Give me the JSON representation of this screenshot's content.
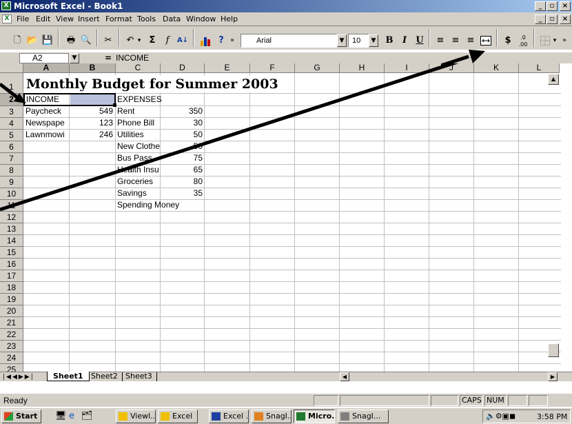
{
  "window": {
    "title": "Microsoft Excel - Book1"
  },
  "menu": [
    "File",
    "Edit",
    "View",
    "Insert",
    "Format",
    "Tools",
    "Data",
    "Window",
    "Help"
  ],
  "toolbar": {
    "font_name": "Arial",
    "font_size": "10",
    "bold": "B",
    "italic": "I",
    "underline": "U",
    "currency": "$"
  },
  "formula_bar": {
    "name_box": "A2",
    "equals": "=",
    "content": "INCOME"
  },
  "columns": [
    "A",
    "B",
    "C",
    "D",
    "E",
    "F",
    "G",
    "H",
    "I",
    "J",
    "K",
    "L"
  ],
  "rows": [
    "1",
    "2",
    "3",
    "4",
    "5",
    "6",
    "7",
    "8",
    "9",
    "10",
    "11",
    "12",
    "13",
    "14",
    "15",
    "16",
    "17",
    "18",
    "19",
    "20",
    "21",
    "22",
    "23",
    "24",
    "25"
  ],
  "sheet": {
    "title": "Monthly Budget for Summer 2003",
    "a2": "INCOME",
    "c2": "EXPENSES",
    "income": [
      {
        "label": "Paycheck",
        "value": "549"
      },
      {
        "label": "Newspape",
        "value": "123"
      },
      {
        "label": "Lawnmowi",
        "value": "246"
      }
    ],
    "expenses": [
      {
        "label": "Rent",
        "value": "350"
      },
      {
        "label": "Phone Bill",
        "value": "30"
      },
      {
        "label": "Utilities",
        "value": "50"
      },
      {
        "label": "New Clothe",
        "value": "50"
      },
      {
        "label": "Bus Pass",
        "value": "75"
      },
      {
        "label": "Health Insu",
        "value": "65"
      },
      {
        "label": "Groceries",
        "value": "80"
      },
      {
        "label": "Savings",
        "value": "35"
      },
      {
        "label": "Spending Money",
        "value": ""
      }
    ]
  },
  "tabs": [
    "Sheet1",
    "Sheet2",
    "Sheet3"
  ],
  "status": {
    "ready": "Ready",
    "caps": "CAPS",
    "num": "NUM"
  },
  "taskbar": {
    "start": "Start",
    "items": [
      "Viewl...",
      "Excel",
      "Excel ...",
      "SnagI...",
      "Micro...",
      "SnagI..."
    ],
    "clock": "3:58 PM"
  }
}
